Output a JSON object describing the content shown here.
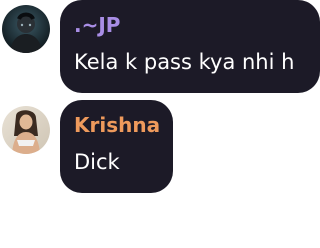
{
  "messages": [
    {
      "sender": ".~JP",
      "name_color": "#a98ee6",
      "text": "Kela k pass kya nhi h",
      "avatar_icon": "user-avatar-icon"
    },
    {
      "sender": "Krishna",
      "name_color": "#ee9a5c",
      "text": "Dick",
      "avatar_icon": "user-avatar-icon"
    }
  ],
  "colors": {
    "bubble_background": "#1c1a27",
    "message_text": "#ffffff",
    "page_background": "#ffffff"
  }
}
